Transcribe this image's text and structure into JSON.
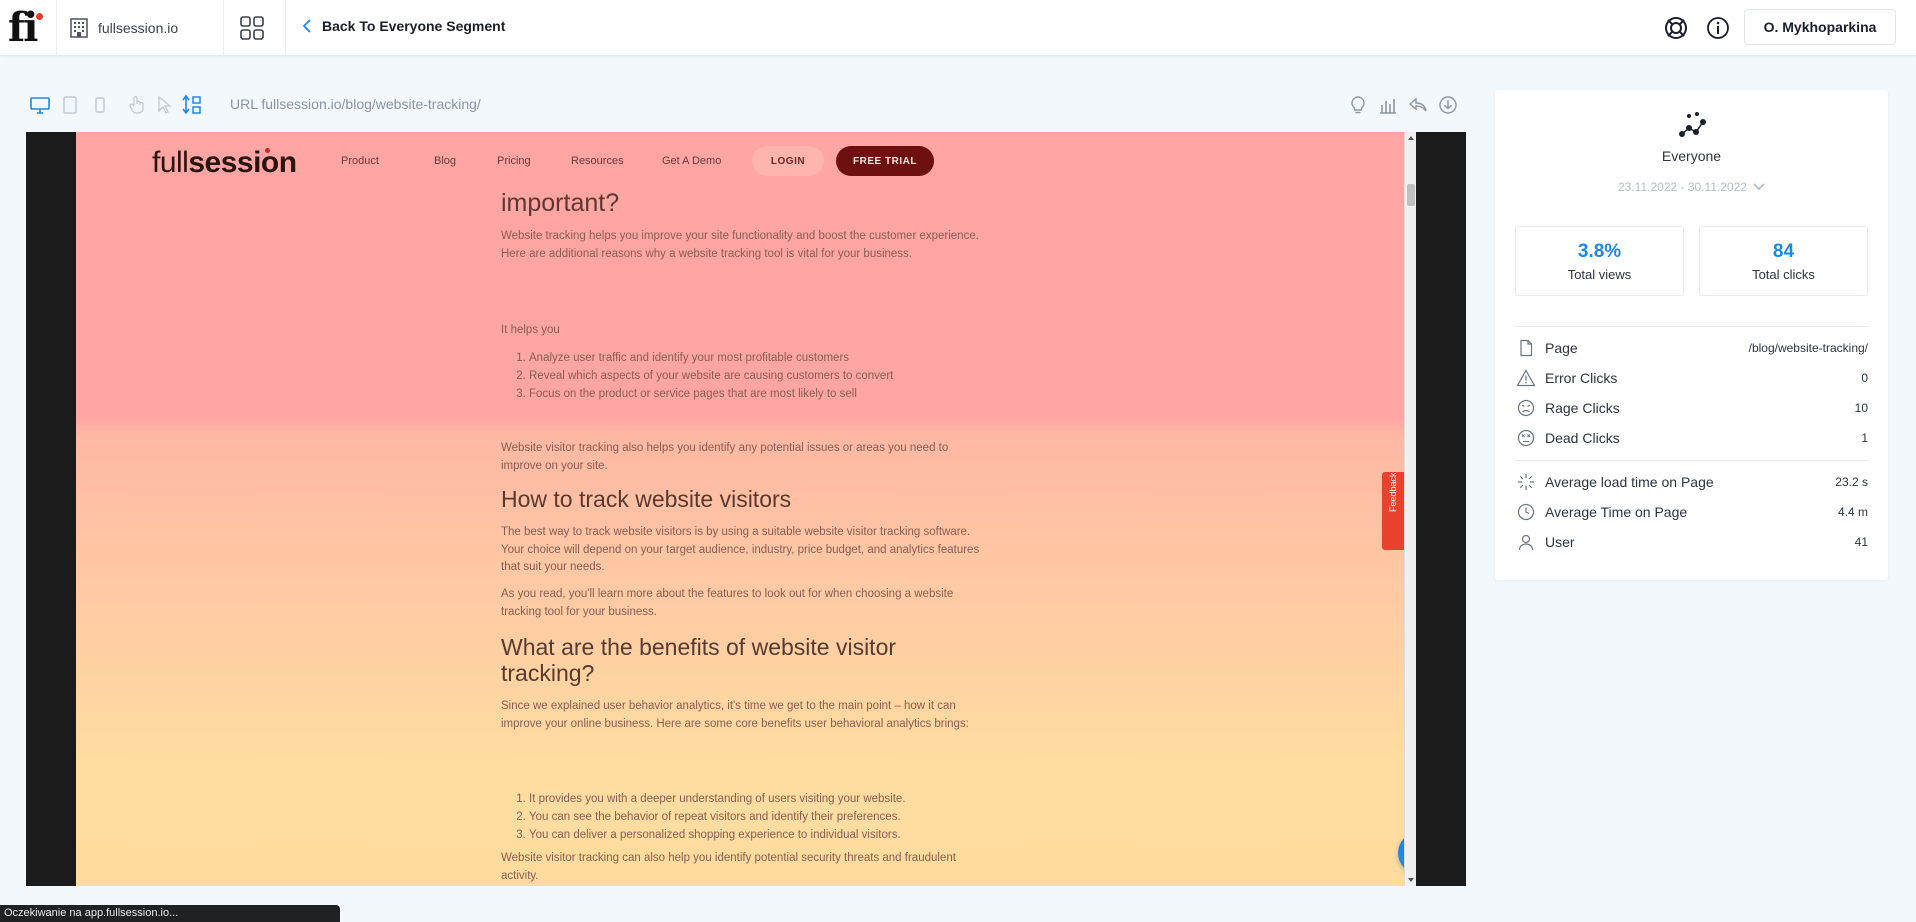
{
  "header": {
    "logo_text": "fi",
    "site_name": "fullsession.io",
    "back_label": "Back To Everyone Segment",
    "user_name": "O. Mykhoparkina"
  },
  "toolbar": {
    "url_label": "URL fullsession.io/blog/website-tracking/",
    "left_icons": [
      "desktop-icon",
      "tablet-icon",
      "mobile-icon",
      "tap-icon",
      "cursor-icon",
      "scroll-icon"
    ],
    "right_icons": [
      "lightbulb-icon",
      "bar-chart-icon",
      "share-icon",
      "download-icon"
    ]
  },
  "site": {
    "brand_light": "full",
    "brand_bold": "session",
    "nav": [
      "Product",
      "Blog",
      "Pricing",
      "Resources",
      "Get A Demo"
    ],
    "login": "LOGIN",
    "trial": "FREE TRIAL"
  },
  "article": {
    "heading_1": "important?",
    "p1": "Website tracking helps you improve your site functionality and boost the customer experience. Here are additional reasons why a website tracking tool is vital for your business.",
    "p2": "It helps you",
    "list_1": [
      "Analyze user traffic and identify your most profitable customers",
      "Reveal which aspects of your website are causing customers to convert",
      "Focus on the product or service pages that are most likely to sell"
    ],
    "p3": "Website visitor tracking also helps you identify any potential issues or areas you need to improve on your site.",
    "heading_2": "How to track website visitors",
    "p4": "The best way to track website visitors is by using a suitable website visitor tracking software. Your choice will depend on your target audience, industry, price budget, and analytics features that suit your needs.",
    "p5": "As you read, you'll learn more about the features to look out for when choosing a website tracking tool for your business.",
    "heading_3": "What are the benefits of website visitor tracking?",
    "p6": "Since we explained user behavior analytics, it's time we get to the main point – how it can improve your online business. Here are some core benefits user behavioral analytics brings:",
    "list_2": [
      "It provides you with a deeper understanding of users visiting your website.",
      "You can see the behavior of repeat visitors and identify their preferences.",
      "You can deliver a personalized shopping experience to individual visitors."
    ],
    "p7": "Website visitor tracking can also help you identify potential security threats and fraudulent activity.",
    "feedback": "Feedback"
  },
  "panel": {
    "segment": "Everyone",
    "date_range": "23.11.2022 - 30.11.2022",
    "stats": [
      {
        "value": "3.8%",
        "label": "Total views"
      },
      {
        "value": "84",
        "label": "Total clicks"
      }
    ],
    "rows": [
      {
        "label": "Page",
        "value": "/blog/website-tracking/",
        "icon": "page-icon"
      },
      {
        "label": "Error Clicks",
        "value": "0",
        "icon": "warning-icon"
      },
      {
        "label": "Rage Clicks",
        "value": "10",
        "icon": "angry-face-icon"
      },
      {
        "label": "Dead Clicks",
        "value": "1",
        "icon": "dead-face-icon"
      },
      {
        "label": "Average load time on Page",
        "value": "23.2 s",
        "icon": "loading-icon"
      },
      {
        "label": "Average Time on Page",
        "value": "4.4 m",
        "icon": "clock-icon"
      },
      {
        "label": "User",
        "value": "41",
        "icon": "user-icon"
      }
    ]
  },
  "status": {
    "text": "Oczekiwanie na app.fullsession.io..."
  },
  "colors": {
    "accent": "#1e88e5",
    "heat_top": "#ffa6a4",
    "heat_bottom": "#ffdc9e"
  }
}
